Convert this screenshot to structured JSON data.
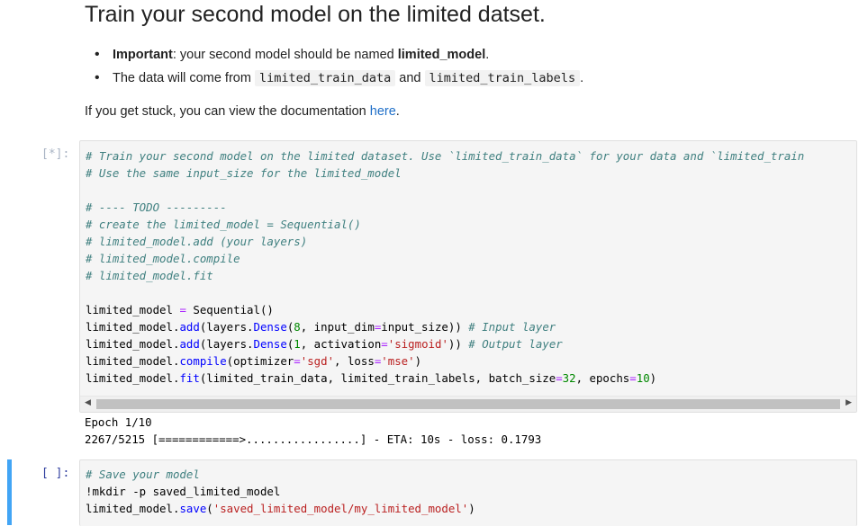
{
  "markdown": {
    "heading": "Train your second model on the limited datset.",
    "bullet1": {
      "bold": "Important",
      "text": ": your second model should be named ",
      "name": "limited_model",
      "end": "."
    },
    "bullet2": {
      "text": "The data will come from ",
      "code1": "limited_train_data",
      "mid": " and ",
      "code2": "limited_train_labels",
      "end": "."
    },
    "para": "If you get stuck, you can view the documentation ",
    "link": "here",
    "para_end": "."
  },
  "cell1": {
    "prompt": "[*]:",
    "lines": {
      "c1": "# Train your second model on the limited dataset. Use `limited_train_data` for your data and `limited_train",
      "c2": "# Use the same input_size for the limited_model",
      "c3": "# ---- TODO ---------",
      "c4": "# create the limited_model = Sequential()",
      "c5": "# limited_model.add (your layers)",
      "c6": "# limited_model.compile",
      "c7": "# limited_model.fit",
      "l1a": "limited_model ",
      "l1b": "=",
      "l1c": " Sequential()",
      "l2a": "limited_model.",
      "l2b": "add",
      "l2c": "(layers.",
      "l2d": "Dense",
      "l2e": "(",
      "l2f": "8",
      "l2g": ", input_dim",
      "l2h": "=",
      "l2i": "input_size)) ",
      "l2j": "# Input layer",
      "l3a": "limited_model.",
      "l3b": "add",
      "l3c": "(layers.",
      "l3d": "Dense",
      "l3e": "(",
      "l3f": "1",
      "l3g": ", activation",
      "l3h": "=",
      "l3i": "'sigmoid'",
      "l3j": ")) ",
      "l3k": "# Output layer",
      "l4a": "limited_model.",
      "l4b": "compile",
      "l4c": "(optimizer",
      "l4d": "=",
      "l4e": "'sgd'",
      "l4f": ", loss",
      "l4g": "=",
      "l4h": "'mse'",
      "l4i": ")",
      "l5a": "limited_model.",
      "l5b": "fit",
      "l5c": "(limited_train_data, limited_train_labels, batch_size",
      "l5d": "=",
      "l5e": "32",
      "l5f": ", epochs",
      "l5g": "=",
      "l5h": "10",
      "l5i": ")"
    },
    "output": {
      "o1": "Epoch 1/10",
      "o2": "2267/5215 [============>.................] - ETA: 10s - loss: 0.1793"
    }
  },
  "cell2": {
    "prompt": "[ ]:",
    "lines": {
      "c1": "# Save your model",
      "l1": "!mkdir -p saved_limited_model",
      "l2a": "limited_model.",
      "l2b": "save",
      "l2c": "(",
      "l2d": "'saved_limited_model/my_limited_model'",
      "l2e": ")"
    }
  },
  "colors": {
    "selection": "#42a5f5",
    "link": "#1e6ec8",
    "comment": "#408080"
  }
}
